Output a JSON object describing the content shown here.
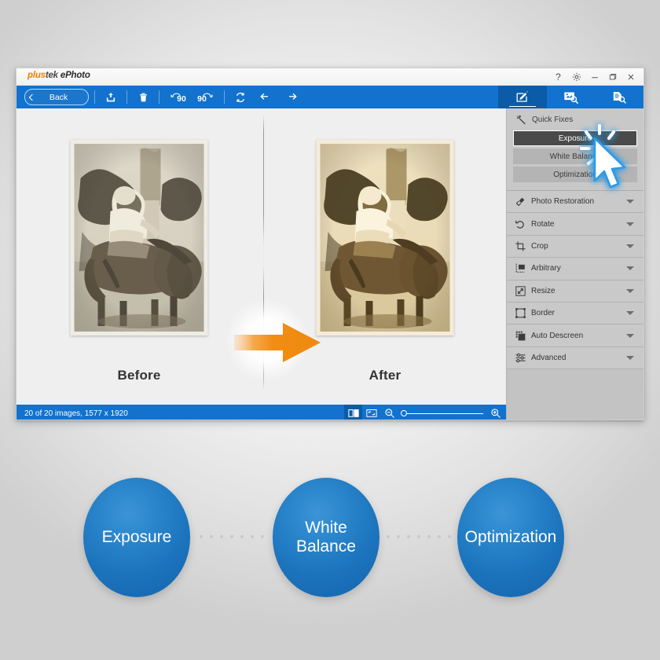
{
  "window": {
    "app_title_plus": "plus",
    "app_title_tek": "tek",
    "app_title_name": " ePhoto",
    "controls": {
      "help": "?",
      "settings_icon": "gear-icon",
      "minimize": "minimize-icon",
      "maximize": "maximize-icon",
      "close": "close-icon"
    }
  },
  "toolbar": {
    "back_label": "Back",
    "export_icon": "export-icon",
    "delete_icon": "trash-icon",
    "rotate_left_label": "90",
    "rotate_right_label": "90",
    "reset_icon": "refresh-icon",
    "undo_icon": "undo-icon",
    "redo_icon": "redo-icon"
  },
  "tabs": [
    {
      "name": "tab-edit",
      "icon": "pencil-edit-icon",
      "active": true
    },
    {
      "name": "tab-image-search",
      "icon": "image-search-icon",
      "active": false
    },
    {
      "name": "tab-document-search",
      "icon": "document-search-icon",
      "active": false
    }
  ],
  "workspace": {
    "before_label": "Before",
    "after_label": "After",
    "arrow_icon": "right-arrow-icon",
    "arrow_color": "#F28C12"
  },
  "statusbar": {
    "text": "20 of 20 images, 1577 x 1920",
    "split_view_icon": "split-view-icon",
    "fit_screen_icon": "fit-to-screen-icon",
    "zoom_out_icon": "zoom-out-icon",
    "zoom_in_icon": "zoom-in-icon",
    "zoom_value": 0
  },
  "sidebar": {
    "quick_fixes": {
      "title": "Quick Fixes",
      "icon": "magic-wand-icon",
      "buttons": [
        {
          "label": "Exposure",
          "selected": true
        },
        {
          "label": "White Balance",
          "selected": false
        },
        {
          "label": "Optimization",
          "selected": false
        }
      ]
    },
    "items": [
      {
        "label": "Photo Restoration",
        "icon": "restoration-brush-icon"
      },
      {
        "label": "Rotate",
        "icon": "rotate-icon"
      },
      {
        "label": "Crop",
        "icon": "crop-icon"
      },
      {
        "label": "Arbitrary",
        "icon": "arbitrary-rotate-icon"
      },
      {
        "label": "Resize",
        "icon": "resize-icon"
      },
      {
        "label": "Border",
        "icon": "border-icon"
      },
      {
        "label": "Auto Descreen",
        "icon": "descreen-icon"
      },
      {
        "label": "Advanced",
        "icon": "sliders-icon"
      }
    ]
  },
  "flow": {
    "nodes": [
      {
        "label": "Exposure"
      },
      {
        "label": "White\nBalance"
      },
      {
        "label": "Optimization"
      }
    ],
    "node_color": "#1C74BD",
    "connector_dots": 7
  },
  "colors": {
    "toolbar_blue": "#1272CD",
    "tab_active_blue": "#0B5CA8",
    "accent_orange": "#F08000",
    "sidebar_gray": "#C3C3C3"
  }
}
